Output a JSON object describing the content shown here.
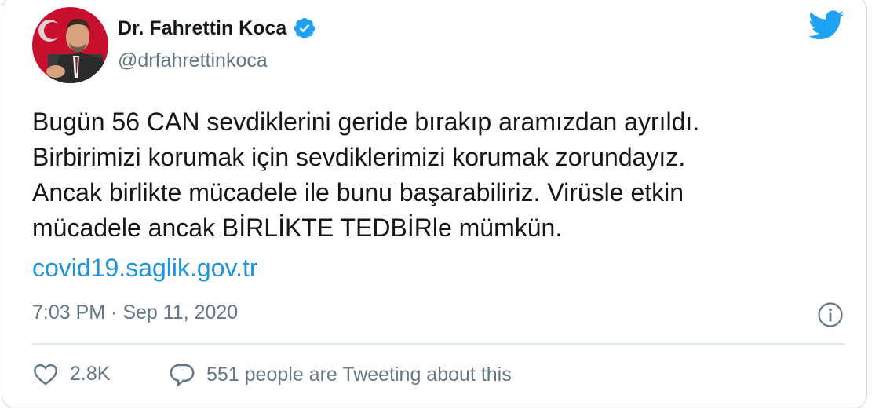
{
  "author": {
    "name": "Dr. Fahrettin Koca",
    "handle": "@drfahrettinkoca",
    "verified": true
  },
  "tweet": {
    "text": "Bugün 56 CAN sevdiklerini geride bırakıp aramızdan ayrıldı.\nBirbirimizi korumak için sevdiklerimizi korumak zorundayız.\nAncak birlikte mücadele ile bunu başarabiliriz. Virüsle etkin\nmücadele ancak BİRLİKTE TEDBİRle mümkün.",
    "link": "covid19.saglik.gov.tr",
    "timestamp": "7:03 PM · Sep 11, 2020"
  },
  "actions": {
    "like_count": "2.8K",
    "conversation_label": "551 people are Tweeting about this"
  },
  "icons": {
    "like": "heart-icon",
    "reply": "speech-bubble-icon",
    "info": "info-icon",
    "brand": "twitter-bird-icon",
    "verified": "verified-badge-icon"
  },
  "colors": {
    "text": "#14171a",
    "secondary": "#657786",
    "link": "#1b95e0",
    "brand": "#1da1f2"
  }
}
